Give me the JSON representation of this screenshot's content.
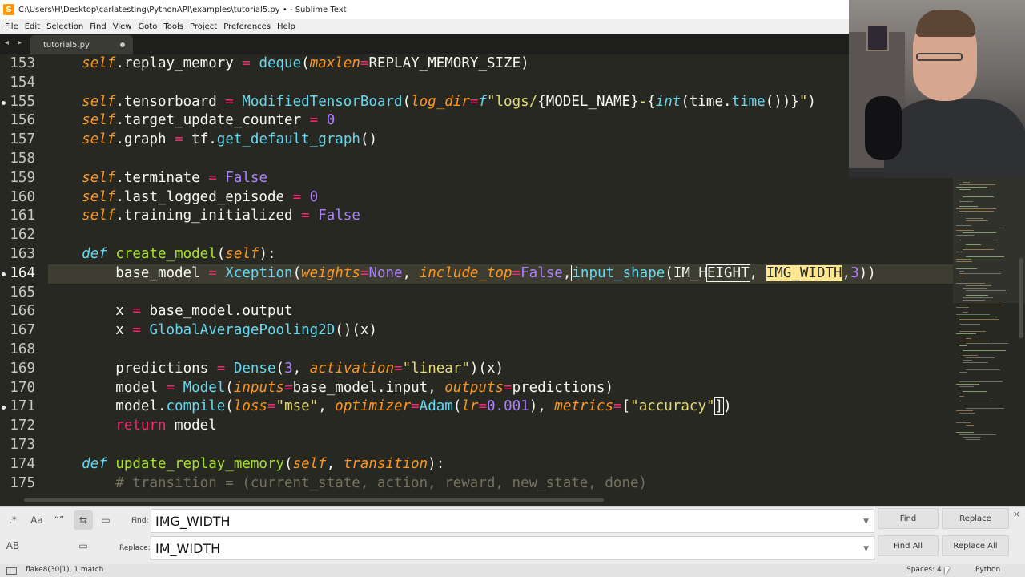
{
  "window": {
    "title": "C:\\Users\\H\\Desktop\\carlatesting\\PythonAPI\\examples\\tutorial5.py • - Sublime Text"
  },
  "menu": [
    "File",
    "Edit",
    "Selection",
    "Find",
    "View",
    "Goto",
    "Tools",
    "Project",
    "Preferences",
    "Help"
  ],
  "tab": {
    "label": "tutorial5.py",
    "nav_arrows": "◂ ▸"
  },
  "editor": {
    "current_line": 164,
    "modified_lines": [
      155,
      164,
      171
    ],
    "line_numbers": [
      "153",
      "154",
      "155",
      "156",
      "157",
      "158",
      "159",
      "160",
      "161",
      "162",
      "163",
      "164",
      "165",
      "166",
      "167",
      "168",
      "169",
      "170",
      "171",
      "172",
      "173",
      "174",
      "175"
    ],
    "lines": [
      "        self.replay_memory = deque(maxlen=REPLAY_MEMORY_SIZE)",
      "",
      "        self.tensorboard = ModifiedTensorBoard(log_dir=f\"logs/{MODEL_NAME}-{int(time.time())}\")",
      "        self.target_update_counter = 0",
      "        self.graph = tf.get_default_graph()",
      "",
      "        self.terminate = False",
      "        self.last_logged_episode = 0",
      "        self.training_initialized = False",
      "",
      "    def create_model(self):",
      "        base_model = Xception(weights=None, include_top=False, input_shape(IM_HEIGHT, IMG_WIDTH,3))",
      "",
      "        x = base_model.output",
      "        x = GlobalAveragePooling2D()(x)",
      "",
      "        predictions = Dense(3, activation=\"linear\")(x)",
      "        model = Model(inputs=base_model.input, outputs=predictions)",
      "        model.compile(loss=\"mse\", optimizer=Adam(lr=0.001), metrics=[\"accuracy\"])",
      "        return model",
      "",
      "    def update_replay_memory(self, transition):",
      "        # transition = (current_state, action, reward, new_state, done)"
    ]
  },
  "find_panel": {
    "options": [
      {
        "name": "regex-toggle",
        "glyph": ".*",
        "active": false
      },
      {
        "name": "case-toggle",
        "glyph": "Aa",
        "active": false
      },
      {
        "name": "whole-word-toggle",
        "glyph": "“”",
        "active": false
      },
      {
        "name": "wrap-toggle",
        "glyph": "⇆",
        "active": true
      },
      {
        "name": "in-selection-toggle",
        "glyph": "▭",
        "active": false
      },
      {
        "name": "preserve-case-toggle",
        "glyph": "AB",
        "active": false
      },
      {
        "name": "highlight-matches-toggle",
        "glyph": "▭",
        "active": false
      }
    ],
    "find_label": "Find:",
    "find_value": "IMG_WIDTH",
    "replace_label": "Replace:",
    "replace_value": "IM_WIDTH",
    "buttons": {
      "find": "Find",
      "replace": "Replace",
      "find_all": "Find All",
      "replace_all": "Replace All"
    },
    "close": "×"
  },
  "status": {
    "text": "flake8(30|1), 1 match",
    "spaces": "Spaces: 4",
    "syntax": "Python"
  },
  "colors": {
    "background": "#272822",
    "keyword": "#66d9ef",
    "operator": "#f92672",
    "string": "#e6db74",
    "number": "#ae81ff",
    "function": "#a6e22e",
    "parameter": "#fd971f",
    "comment": "#75715e"
  }
}
